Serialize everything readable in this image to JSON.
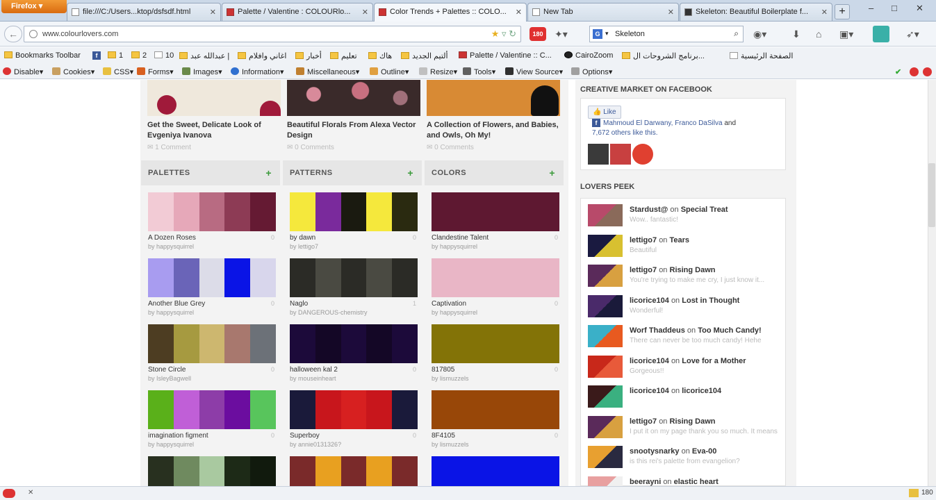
{
  "browser": {
    "menu_label": "Firefox",
    "tabs": [
      {
        "title": "file:///C:/Users...ktop/dsfsdf.html"
      },
      {
        "title": "Palette / Valentine : COLOURlo..."
      },
      {
        "title": "Color Trends + Palettes :: COLO..."
      },
      {
        "title": "New Tab"
      },
      {
        "title": "Skeleton: Beautiful Boilerplate f..."
      }
    ],
    "new_tab_label": "+",
    "window_controls": [
      "–",
      "□",
      "✕"
    ],
    "url": "www.colourlovers.com",
    "search_engine_label": "G",
    "search_value": "Skeleton",
    "addon_badge": "180",
    "bookmarks": [
      {
        "label": "Bookmarks Toolbar"
      },
      {
        "label": "1"
      },
      {
        "label": "2"
      },
      {
        "label": "10"
      },
      {
        "label": "عبدالله عبد |"
      },
      {
        "label": "اغاني وافلام"
      },
      {
        "label": "أخبار"
      },
      {
        "label": "تعليم"
      },
      {
        "label": "هاك"
      },
      {
        "label": "ألتيم الجديد"
      },
      {
        "label": "Palette / Valentine :: C..."
      },
      {
        "label": "CairoZoom"
      },
      {
        "label": "برنامج الشروحات ال..."
      },
      {
        "label": "الصفحة الرئيسية"
      }
    ],
    "devbar": [
      "Disable",
      "Cookies",
      "CSS",
      "Forms",
      "Images",
      "Information",
      "Miscellaneous",
      "Outline",
      "Resize",
      "Tools",
      "View Source",
      "Options"
    ],
    "status_count": "180"
  },
  "featured": [
    {
      "title": "Get the Sweet, Delicate Look of Evgeniya Ivanova",
      "meta": "1 Comment"
    },
    {
      "title": "Beautiful Florals From Alexa Vector Design",
      "meta": "0 Comments"
    },
    {
      "title": "A Collection of Flowers, and Babies, and Owls, Oh My!",
      "meta": "0 Comments"
    }
  ],
  "columns": {
    "palettes": {
      "title": "PALETTES",
      "items": [
        {
          "name": "A Dozen Roses",
          "by": "by happysquirrel",
          "count": "0",
          "colors": [
            "#f2cbd5",
            "#e6a8b9",
            "#b86b82",
            "#8d3b55",
            "#651a33"
          ]
        },
        {
          "name": "Another Blue Grey",
          "by": "by happysquirrel",
          "count": "0",
          "colors": [
            "#a89cf0",
            "#6a64b8",
            "#dcdce8",
            "#0a14e6",
            "#d8d6ec"
          ]
        },
        {
          "name": "Stone Circle",
          "by": "by IsleyBagwell",
          "count": "0",
          "colors": [
            "#4d3d22",
            "#a69a40",
            "#cdb76f",
            "#a8786e",
            "#6c7178"
          ]
        },
        {
          "name": "imagination figment",
          "by": "by happysquirrel",
          "count": "0",
          "colors": [
            "#5ab01a",
            "#c05fd7",
            "#8d3da8",
            "#6b0d9f",
            "#58c55c"
          ]
        },
        {
          "name": "",
          "by": "",
          "count": "",
          "colors": [
            "#28301f",
            "#6f8a5f",
            "#a9c9a0",
            "#1d2a17",
            "#111a0d"
          ]
        }
      ]
    },
    "patterns": {
      "title": "PATTERNS",
      "items": [
        {
          "name": "by dawn",
          "by": "by lettigo7",
          "count": "0",
          "colors": [
            "#f5e83c",
            "#7a2a9c",
            "#1a1a10",
            "#f5e83c",
            "#2a2a10"
          ]
        },
        {
          "name": "Naglo",
          "by": "by DANGEROUS-chemistry",
          "count": "1",
          "colors": [
            "#2b2b26",
            "#4a4a42",
            "#2b2b26",
            "#4a4a42",
            "#2b2b26"
          ]
        },
        {
          "name": "halloween kal 2",
          "by": "by mouseinheart",
          "count": "0",
          "colors": [
            "#1c0a3a",
            "#140726",
            "#1c0a3a",
            "#140726",
            "#1c0a3a"
          ]
        },
        {
          "name": "Superboy",
          "by": "by annie0131326?",
          "count": "0",
          "colors": [
            "#1a1a3a",
            "#c8161c",
            "#d72020",
            "#c8161c",
            "#1a1a3a"
          ]
        },
        {
          "name": "",
          "by": "",
          "count": "",
          "colors": [
            "#7a2a2a",
            "#e8a020",
            "#7a2a2a",
            "#e8a020",
            "#7a2a2a"
          ]
        }
      ]
    },
    "colors": {
      "title": "COLORS",
      "items": [
        {
          "name": "Clandestine Talent",
          "by": "by happysquirrel",
          "count": "0",
          "colors": [
            "#5e1831"
          ]
        },
        {
          "name": "Captivation",
          "by": "by happysquirrel",
          "count": "0",
          "colors": [
            "#e9b6c6"
          ]
        },
        {
          "name": "817805",
          "by": "by lismuzzels",
          "count": "0",
          "colors": [
            "#837307"
          ]
        },
        {
          "name": "8F4105",
          "by": "by lismuzzels",
          "count": "0",
          "colors": [
            "#984708"
          ]
        },
        {
          "name": "",
          "by": "",
          "count": "",
          "colors": [
            "#0a14e6"
          ]
        }
      ]
    }
  },
  "sidebar": {
    "facebook_title": "CREATIVE MARKET ON FACEBOOK",
    "like_label": "Like",
    "fb_names": "Mahmoud El Darwany, Franco DaSilva",
    "fb_and": "and",
    "fb_rest": "7,672 others like this.",
    "lovers_title": "LOVERS PEEK",
    "lovers": [
      {
        "user": "Stardust@",
        "on": "on",
        "item": "Special Treat",
        "sub": "Wow.. fantastic!",
        "colors": [
          "#b84a6a",
          "#8a6a5a"
        ]
      },
      {
        "user": "lettigo7",
        "on": "on",
        "item": "Tears",
        "sub": "Beautiful",
        "colors": [
          "#1a1a40",
          "#d8c030"
        ]
      },
      {
        "user": "lettigo7",
        "on": "on",
        "item": "Rising Dawn",
        "sub": "You're trying to make me cry, I just know it...",
        "colors": [
          "#5a2a5a",
          "#d8a040"
        ]
      },
      {
        "user": "licorice104",
        "on": "on",
        "item": "Lost in Thought",
        "sub": "Wonderful!",
        "colors": [
          "#4a2a6a",
          "#1a1a3a"
        ]
      },
      {
        "user": "Worf Thaddeus",
        "on": "on",
        "item": "Too Much Candy!",
        "sub": "There can never be too much candy! Hehe",
        "colors": [
          "#3ab0c8",
          "#e85a20"
        ]
      },
      {
        "user": "licorice104",
        "on": "on",
        "item": "Love for a Mother",
        "sub": "Gorgeous!!",
        "colors": [
          "#c8281a",
          "#e85a3a"
        ]
      },
      {
        "user": "licorice104",
        "on": "on",
        "item": "licorice104",
        "sub": "",
        "colors": [
          "#3a1a1a",
          "#3ab080"
        ]
      },
      {
        "user": "lettigo7",
        "on": "on",
        "item": "Rising Dawn",
        "sub": "I put it on my page thank you so much. It means",
        "colors": [
          "#5a2a5a",
          "#d8a040"
        ]
      },
      {
        "user": "snootysnarky",
        "on": "on",
        "item": "Eva-00",
        "sub": "is this rei's palette from evangelion?",
        "colors": [
          "#e8a030",
          "#2a2a40"
        ]
      },
      {
        "user": "beerayni",
        "on": "on",
        "item": "elastic heart",
        "sub": "",
        "colors": [
          "#e8a0a0",
          "#f0f0f0"
        ]
      }
    ]
  }
}
